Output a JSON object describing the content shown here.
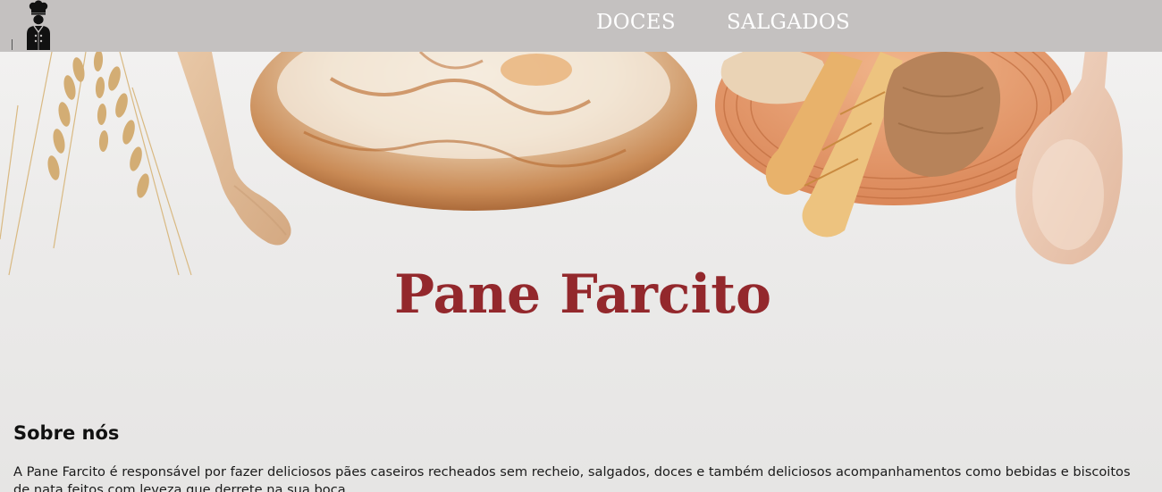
{
  "nav": {
    "logo_icon": "chef-icon",
    "links": [
      {
        "label": "DOCES"
      },
      {
        "label": "SALGADOS"
      }
    ]
  },
  "hero": {
    "brand_title": "Pane Farcito",
    "decorations": [
      "wheat-icon",
      "rolling-pin-icon",
      "bread-loaf-icon",
      "bread-basket-icon",
      "wooden-spoon-icon"
    ]
  },
  "about": {
    "title": "Sobre nós",
    "text": "A Pane Farcito é responsável por fazer deliciosos pães caseiros recheados sem recheio, salgados, doces e também deliciosos acompanhamentos como bebidas e biscoitos de nata feitos com leveza que derrete na sua boca."
  },
  "colors": {
    "navbar_bg": "#c4c1c0",
    "nav_text": "#ffffff",
    "brand": "#93282c",
    "body_text": "#1a1a1a"
  }
}
